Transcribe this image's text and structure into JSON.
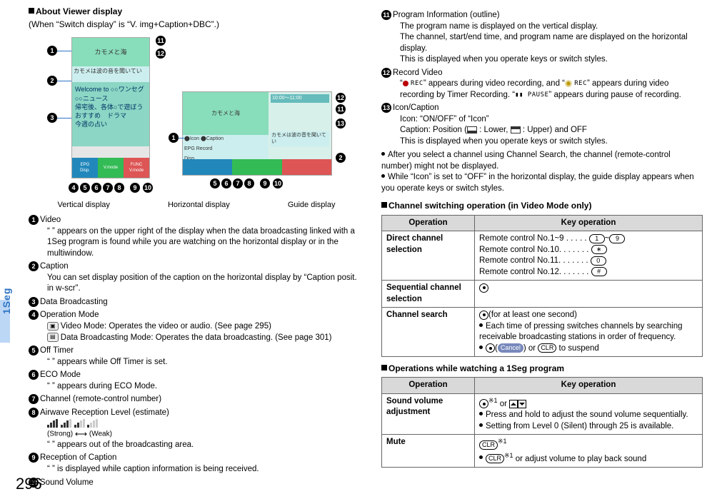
{
  "page_number": "296",
  "side_tab": "1Seg",
  "left": {
    "section_title": "About Viewer display",
    "subtitle": "(When “Switch display” is “V. img+Caption+DBC”.)",
    "diagram": {
      "vert_channel": "カモメと海",
      "vert_caption": "カモメは波の音を聞いてい",
      "vert_dbc_l1": "Welcome to ○○ワンセグ",
      "vert_dbc_l2": "○○ニュース",
      "vert_dbc_l3": "帰宅後、各体○で遊ぼう",
      "vert_dbc_l4": "おすすめ　ドラマ",
      "vert_dbc_l5": "今週の占い",
      "bar_l1a": "EPG",
      "bar_l1b": "Disp.",
      "bar_l2a": "",
      "bar_l2b": "V.mode",
      "bar_l3a": "FUNC",
      "bar_l3b": "V.mode",
      "horiz_channel": "カモメと海",
      "horiz_row1_icon": "Icon",
      "horiz_row1_cap": "Caption",
      "horiz_row2_epg": "EPG",
      "horiz_row2_rec": "Record",
      "horiz_row2_disp": "Disp.",
      "horiz_time": "10:00～11:00",
      "horiz_text": "カモメは波の音を聞いてい",
      "vertical_label": "Vertical display",
      "horizontal_label": "Horizontal display",
      "guide_label": "Guide display"
    },
    "items": {
      "i1": {
        "title": "Video",
        "body": "“ ” appears on the upper right of the display when the data broadcasting linked with a 1Seg program is found while you are watching on the horizontal display or in the multiwindow."
      },
      "i2": {
        "title": "Caption",
        "body": "You can set display position of the caption on the horizontal display by “Caption posit. in w-scr”."
      },
      "i3": {
        "title": "Data Broadcasting"
      },
      "i4": {
        "title": "Operation Mode",
        "l1": "Video Mode: Operates the video or audio. (See page 295)",
        "l2": "Data Broadcasting Mode: Operates the data broadcasting. (See page 301)"
      },
      "i5": {
        "title": "Off Timer",
        "body": "“ ” appears while Off Timer is set."
      },
      "i6": {
        "title": "ECO Mode",
        "body": "“ ” appears during ECO Mode."
      },
      "i7": {
        "title": "Channel (remote-control number)"
      },
      "i8": {
        "title": "Airwave Reception Level (estimate)",
        "strong": "(Strong)",
        "weak": "(Weak)",
        "body": "“ ” appears out of the broadcasting area."
      },
      "i9": {
        "title": "Reception of Caption",
        "body": "“ ” is displayed while caption information is being received."
      },
      "i10": {
        "title": "Sound Volume"
      }
    }
  },
  "right": {
    "items": {
      "i11": {
        "title": "Program Information (outline)",
        "l1": "The program name is displayed on the vertical display.",
        "l2": "The channel, start/end time, and program name are displayed on the horizontal display.",
        "l3": "This is displayed when you operate keys or switch styles."
      },
      "i12": {
        "title": "Record Video",
        "l1_pre": "“",
        "l1_rec": "REC",
        "l1_mid": "” appears during video recording, and “",
        "l1_rec2": "REC",
        "l1_post": "” appears during video recording by Timer Recording. “",
        "l1_pause": "PAUSE",
        "l1_end": "” appears during pause of recording."
      },
      "i13": {
        "title": "Icon/Caption",
        "l1": "Icon: “ON/OFF” of “Icon”",
        "l2_pre": "Caption: Position (",
        "l2_mid": ": Lower, ",
        "l2_post": ": Upper) and OFF",
        "l3": "This is displayed when you operate keys or switch styles."
      }
    },
    "notes": {
      "n1": "After you select a channel using Channel Search, the channel (remote-control number) might not be displayed.",
      "n2": "While “Icon” is set to “OFF” in the horizontal display, the guide display appears when you operate keys or switch styles."
    },
    "table1_title": "Channel switching operation (in Video Mode only)",
    "table1": {
      "h1": "Operation",
      "h2": "Key operation",
      "r1_op": "Direct channel selection",
      "r1_l1": "Remote control No.1~9",
      "r1_l2": "Remote control No.10.",
      "r1_l3": "Remote control No.11.",
      "r1_l4": "Remote control No.12.",
      "k1": "1",
      "k9": "9",
      "kast": "∗",
      "k0": "0",
      "khash": "#",
      "r2_op": "Sequential channel selection",
      "r3_op": "Channel search",
      "r3_l1": "(for at least one second)",
      "r3_l2": "Each time of pressing switches channels by searching receivable broadcasting stations in order of frequency.",
      "r3_cancel": "Cancel",
      "r3_clr": "CLR",
      "r3_l3": " to suspend"
    },
    "table2_title": "Operations while watching a 1Seg program",
    "table2": {
      "h1": "Operation",
      "h2": "Key operation",
      "r1_op": "Sound volume adjustment",
      "r1_sup": "※1",
      "r1_or": " or ",
      "r1_l1": "Press and hold to adjust the sound volume sequentially.",
      "r1_l2": "Setting from Level 0 (Silent) through 25 is available.",
      "r2_op": "Mute",
      "r2_clr": "CLR",
      "r2_sup": "※1",
      "r2_l1": " or adjust volume to play back sound"
    }
  }
}
